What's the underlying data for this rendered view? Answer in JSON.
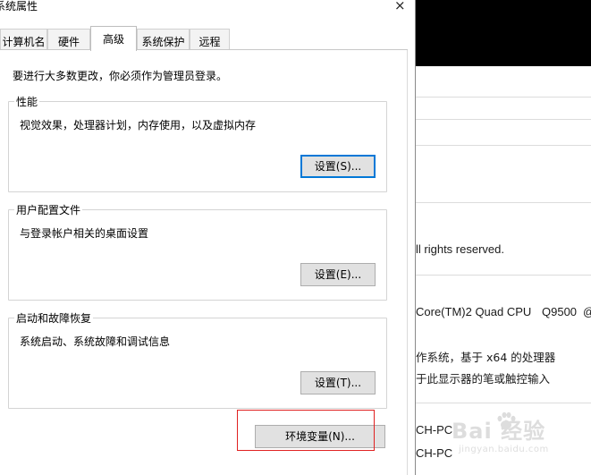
{
  "dialog": {
    "title": "系统属性",
    "close_glyph": "×",
    "tabs": [
      {
        "label": "计算机名"
      },
      {
        "label": "硬件"
      },
      {
        "label": "高级"
      },
      {
        "label": "系统保护"
      },
      {
        "label": "远程"
      }
    ],
    "active_tab": "高级",
    "notice": "要进行大多数更改，你必须作为管理员登录。",
    "performance": {
      "legend": "性能",
      "description": "视觉效果，处理器计划，内存使用，以及虚拟内存",
      "button_label": "设置(S)..."
    },
    "user_profiles": {
      "legend": "用户配置文件",
      "description": "与登录帐户相关的桌面设置",
      "button_label": "设置(E)..."
    },
    "startup_recovery": {
      "legend": "启动和故障恢复",
      "description": "系统启动、系统故障和调试信息",
      "button_label": "设置(T)..."
    },
    "env_button_label": "环境变量(N)..."
  },
  "background_window": {
    "rights_text": "ll rights reserved.",
    "cpu_name": "Core(TM)2 Quad CPU",
    "cpu_model": "Q9500",
    "cpu_at": "@",
    "system_type": "作系统，基于 x64 的处理器",
    "pen_touch": "于此显示器的笔或触控输入",
    "computer_name": "CH-PC",
    "full_name": "CH-PC"
  },
  "watermark": {
    "brand": "Bai 经验",
    "url": "jingyan.baidu.com"
  },
  "colors": {
    "accent_focus": "#0078d7",
    "highlight_box": "#e02020",
    "button_face": "#e1e1e1"
  }
}
